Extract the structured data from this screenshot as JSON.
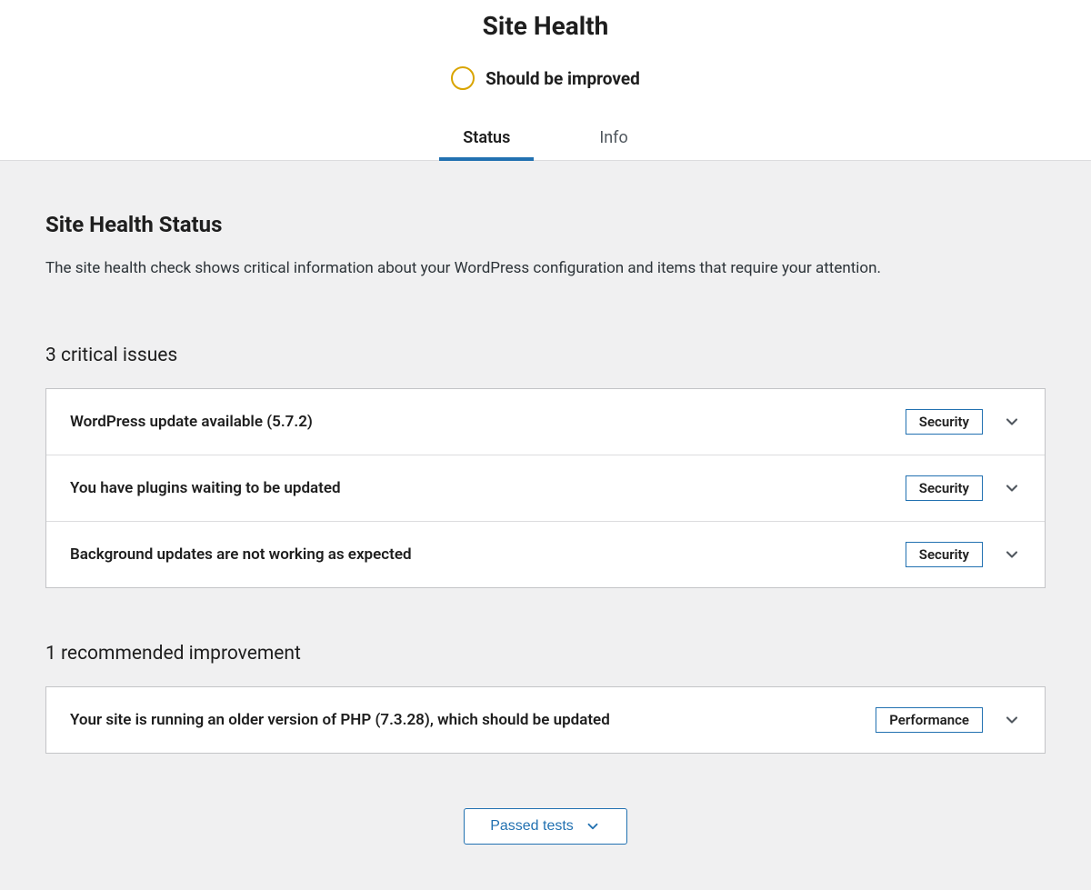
{
  "header": {
    "title": "Site Health",
    "status_text": "Should be improved",
    "status_color": "#d9a400"
  },
  "tabs": [
    {
      "label": "Status",
      "active": true
    },
    {
      "label": "Info",
      "active": false
    }
  ],
  "main": {
    "title": "Site Health Status",
    "description": "The site health check shows critical information about your WordPress configuration and items that require your attention."
  },
  "critical": {
    "heading": "3 critical issues",
    "items": [
      {
        "title": "WordPress update available (5.7.2)",
        "badge": "Security"
      },
      {
        "title": "You have plugins waiting to be updated",
        "badge": "Security"
      },
      {
        "title": "Background updates are not working as expected",
        "badge": "Security"
      }
    ]
  },
  "recommended": {
    "heading": "1 recommended improvement",
    "items": [
      {
        "title": "Your site is running an older version of PHP (7.3.28), which should be updated",
        "badge": "Performance"
      }
    ]
  },
  "passed_button": "Passed tests"
}
